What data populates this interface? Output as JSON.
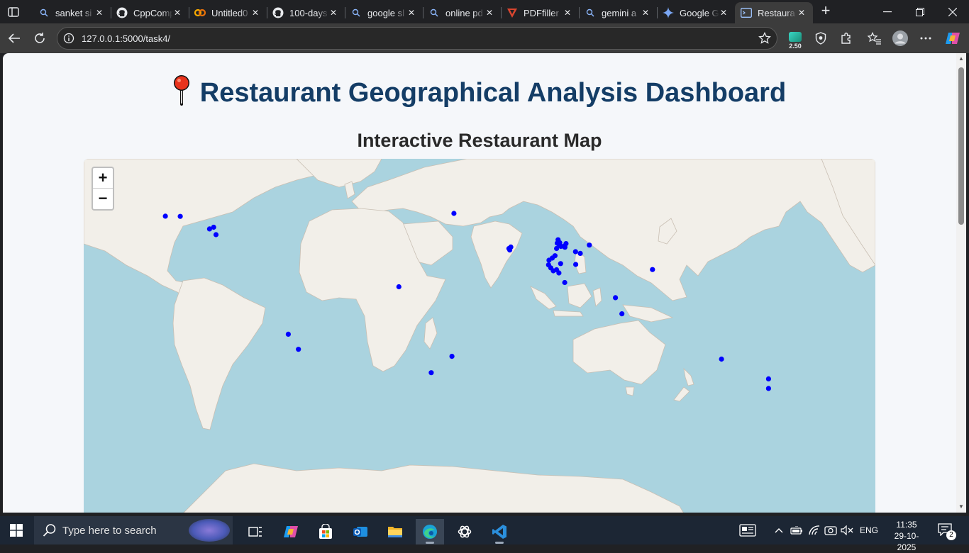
{
  "browser": {
    "tabs": [
      {
        "title": "sanket si",
        "icon": "search-icon",
        "active": false
      },
      {
        "title": "CppComp",
        "icon": "github-icon",
        "active": false
      },
      {
        "title": "Untitled0",
        "icon": "colab-icon",
        "active": false
      },
      {
        "title": "100-days",
        "icon": "github-icon",
        "active": false
      },
      {
        "title": "google sl",
        "icon": "search-icon",
        "active": false
      },
      {
        "title": "online pd",
        "icon": "search-icon",
        "active": false
      },
      {
        "title": "PDFfiller",
        "icon": "pdffiller-icon",
        "active": false
      },
      {
        "title": "gemini a",
        "icon": "search-icon",
        "active": false
      },
      {
        "title": "Google G",
        "icon": "gemini-icon",
        "active": false
      },
      {
        "title": "Restaura",
        "icon": "terminal-tab-icon",
        "active": true
      }
    ],
    "url": "127.0.0.1:5000/task4/",
    "extension_badge": "2.50"
  },
  "page": {
    "title_emoji": "📍",
    "title": "Restaurant Geographical Analysis Dashboard",
    "section_title": "Interactive Restaurant Map",
    "zoom_in": "+",
    "zoom_out": "−",
    "marker_color": "#0000ff",
    "restaurant_markers": [
      {
        "lon": -104.9,
        "lat": 39.7
      },
      {
        "lon": -98.0,
        "lat": 39.6
      },
      {
        "lon": -84.4,
        "lat": 33.7
      },
      {
        "lon": -81.4,
        "lat": 31.0
      },
      {
        "lon": -82.5,
        "lat": 34.5
      },
      {
        "lon": 28.9,
        "lat": 41.0
      },
      {
        "lon": 55.3,
        "lat": 25.2
      },
      {
        "lon": 54.4,
        "lat": 24.5
      },
      {
        "lon": 54.8,
        "lat": 23.8
      },
      {
        "lon": 77.2,
        "lat": 28.6
      },
      {
        "lon": 78.0,
        "lat": 27.2
      },
      {
        "lon": 76.8,
        "lat": 27.0
      },
      {
        "lon": 77.6,
        "lat": 26.5
      },
      {
        "lon": 78.5,
        "lat": 25.5
      },
      {
        "lon": 76.5,
        "lat": 24.5
      },
      {
        "lon": 80.9,
        "lat": 26.8
      },
      {
        "lon": 79.8,
        "lat": 25.5
      },
      {
        "lon": 80.4,
        "lat": 25.1
      },
      {
        "lon": 85.3,
        "lat": 23.0
      },
      {
        "lon": 87.5,
        "lat": 22.2
      },
      {
        "lon": 91.7,
        "lat": 26.1
      },
      {
        "lon": 75.8,
        "lat": 21.1
      },
      {
        "lon": 74.5,
        "lat": 20.0
      },
      {
        "lon": 73.0,
        "lat": 19.0
      },
      {
        "lon": 78.4,
        "lat": 17.4
      },
      {
        "lon": 72.8,
        "lat": 16.8
      },
      {
        "lon": 73.8,
        "lat": 15.4
      },
      {
        "lon": 75.0,
        "lat": 14.0
      },
      {
        "lon": 77.6,
        "lat": 13.0
      },
      {
        "lon": 76.5,
        "lat": 14.5
      },
      {
        "lon": 80.3,
        "lat": 8.5
      },
      {
        "lon": 85.4,
        "lat": 17.0
      },
      {
        "lon": 121.0,
        "lat": 14.6
      },
      {
        "lon": 103.8,
        "lat": 1.35
      },
      {
        "lon": 106.8,
        "lat": -6.2
      },
      {
        "lon": 3.4,
        "lat": 6.5
      },
      {
        "lon": -47.9,
        "lat": -15.8
      },
      {
        "lon": -43.2,
        "lat": -22.9
      },
      {
        "lon": 28.0,
        "lat": -26.2
      },
      {
        "lon": 18.4,
        "lat": -33.9
      },
      {
        "lon": 153.0,
        "lat": -27.5
      },
      {
        "lon": 174.8,
        "lat": -36.8
      },
      {
        "lon": 174.8,
        "lat": -41.3
      }
    ]
  },
  "taskbar": {
    "search_placeholder": "Type here to search",
    "language": "ENG",
    "time": "11:35",
    "date": "29-10-2025",
    "notification_count": "2"
  }
}
